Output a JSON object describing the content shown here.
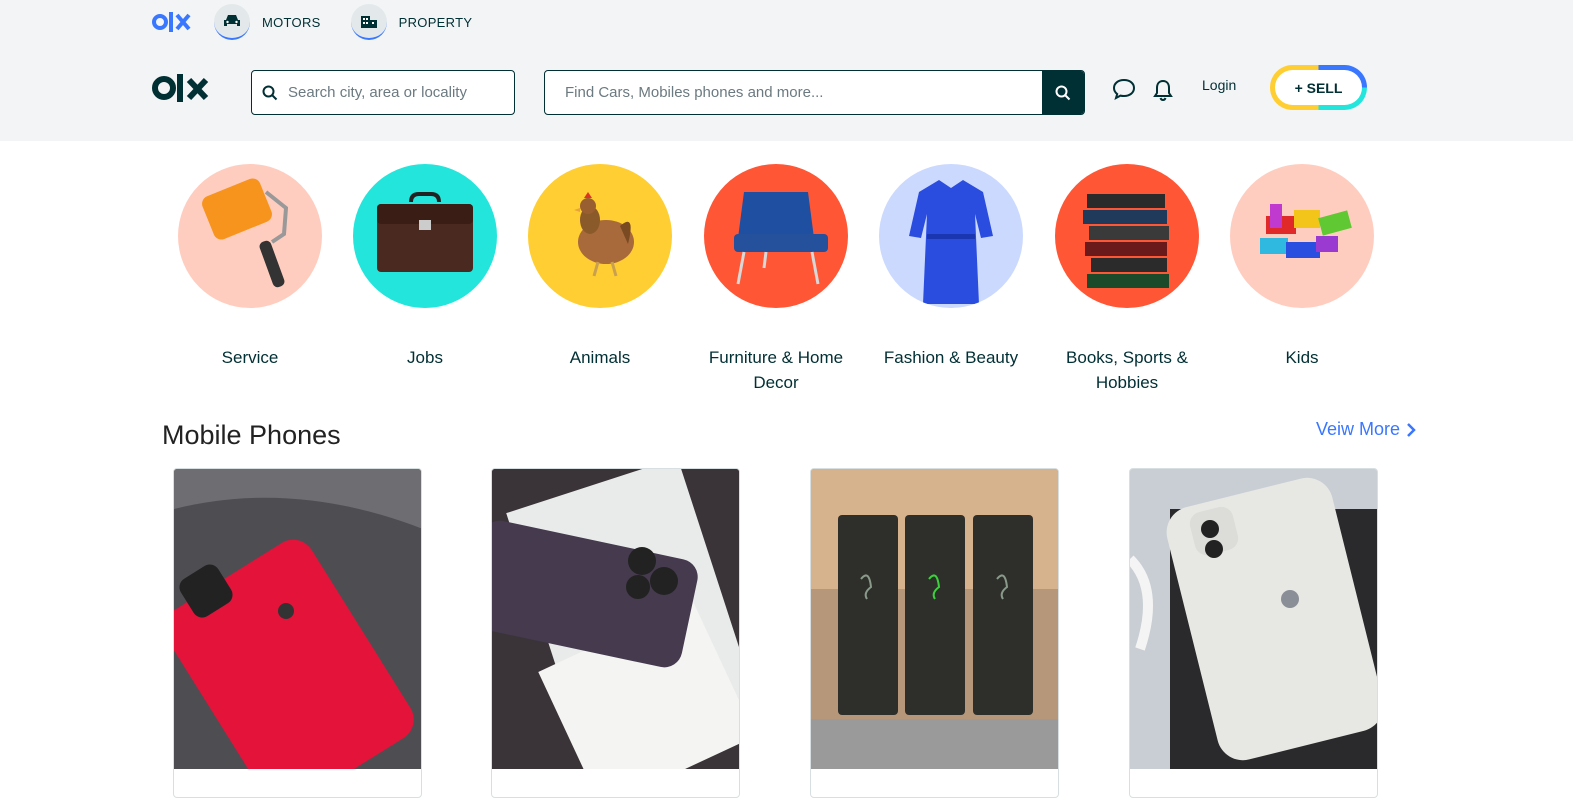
{
  "topnav": {
    "motors_label": "MOTORS",
    "property_label": "PROPERTY"
  },
  "search": {
    "location_placeholder": "Search city, area or locality",
    "query_placeholder": "Find Cars, Mobiles phones and more..."
  },
  "header": {
    "login_label": "Login",
    "sell_label": "+ SELL"
  },
  "categories": [
    {
      "label": "Service",
      "color": "#ffcdbf",
      "icon": "paint-roller-icon"
    },
    {
      "label": "Jobs",
      "color": "#23e5db",
      "icon": "briefcase-icon"
    },
    {
      "label": "Animals",
      "color": "#ffce32",
      "icon": "hen-icon"
    },
    {
      "label": "Furniture & Home Decor",
      "color": "#ff5636",
      "icon": "armchair-icon"
    },
    {
      "label": "Fashion & Beauty",
      "color": "#cbd9ff",
      "icon": "dress-icon"
    },
    {
      "label": "Books, Sports & Hobbies",
      "color": "#ff5636",
      "icon": "books-icon"
    },
    {
      "label": "Kids",
      "color": "#ffcdbf",
      "icon": "toy-bricks-icon"
    }
  ],
  "section": {
    "title": "Mobile Phones",
    "view_more": "Veiw More"
  },
  "listings": [
    {
      "image": "red-iphone-photo"
    },
    {
      "image": "purple-iphone-photo"
    },
    {
      "image": "razer-phones-photo"
    },
    {
      "image": "white-iphone-photo"
    }
  ]
}
